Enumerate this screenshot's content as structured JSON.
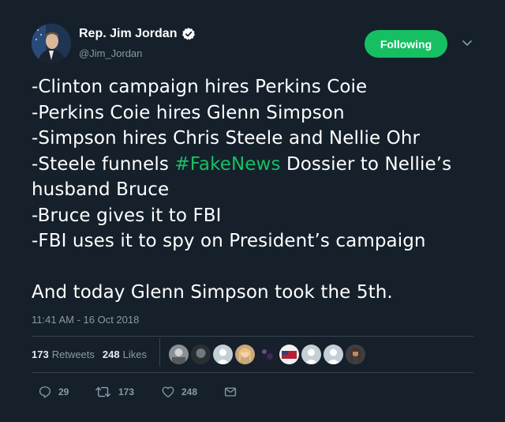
{
  "author": {
    "display_name": "Rep. Jim Jordan",
    "handle": "@Jim_Jordan",
    "verified_icon": "verified-badge-icon"
  },
  "follow_button_label": "Following",
  "tweet": {
    "lines": [
      {
        "text": "-Clinton campaign hires Perkins Coie"
      },
      {
        "text": "-Perkins Coie hires Glenn Simpson"
      },
      {
        "text": "-Simpson hires Chris Steele and Nellie Ohr"
      },
      {
        "before": "-Steele funnels ",
        "hashtag": "#FakeNews",
        "after": " Dossier to Nellie’s"
      },
      {
        "text": "husband Bruce"
      },
      {
        "text": "-Bruce gives it to FBI"
      },
      {
        "text": "-FBI uses it to spy on President’s campaign"
      },
      {
        "text": "And today Glenn Simpson took the 5th."
      }
    ],
    "timestamp": "11:41 AM - 16 Oct 2018"
  },
  "stats": {
    "retweets_count": "173",
    "retweets_label": "Retweets",
    "likes_count": "248",
    "likes_label": "Likes"
  },
  "actions": {
    "reply_count": "29",
    "retweet_count": "173",
    "like_count": "248"
  },
  "colors": {
    "background": "#15202b",
    "accent": "#17bf63",
    "muted": "#8899a6",
    "divider": "#38444d"
  }
}
